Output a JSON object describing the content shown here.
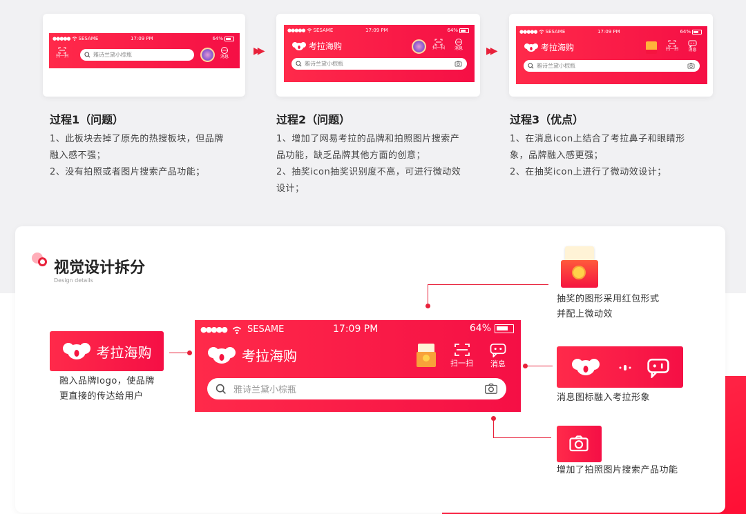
{
  "colors": {
    "accent": "#e8213a",
    "brand_red": "#ff1f47"
  },
  "phone_mock": {
    "carrier": "SESAME",
    "time": "17:09 PM",
    "battery": "64%",
    "search_placeholder": "雅诗兰黛小棕瓶",
    "brand": "考拉海购",
    "scan_label": "扫一扫",
    "message_label": "消息"
  },
  "processes": [
    {
      "title": "过程1（问题）",
      "lines": [
        "1、此板块去掉了原先的热搜板块，但品牌",
        "融入感不强；",
        "2、没有拍照或者图片搜索产品功能；"
      ]
    },
    {
      "title": "过程2（问题）",
      "lines": [
        "1、增加了网易考拉的品牌和拍照图片搜索产",
        "品功能，缺乏品牌其他方面的创意；",
        "2、抽奖icon抽奖识别度不高，可进行微动效",
        "设计；"
      ]
    },
    {
      "title": "过程3（优点）",
      "lines": [
        "1、在消息icon上结合了考拉鼻子和眼睛形",
        "象，品牌融入感更强；",
        "2、在抽奖icon上进行了微动效设计；"
      ]
    }
  ],
  "section": {
    "title": "视觉设计拆分",
    "subtitle": "Design details"
  },
  "annotations": {
    "logo": [
      "融入品牌logo，使品牌",
      "更直接的传达给用户"
    ],
    "lottery": [
      "抽奖的图形采用红包形式",
      "并配上微动效"
    ],
    "message": "消息图标融入考拉形象",
    "camera": "增加了拍照图片搜索产品功能"
  },
  "icons": [
    "scan-icon",
    "message-icon",
    "koala-logo-icon",
    "search-icon",
    "camera-icon",
    "lottery-redpacket-icon",
    "avatar-icon",
    "wifi-icon",
    "battery-icon",
    "arrow-right-icon"
  ]
}
